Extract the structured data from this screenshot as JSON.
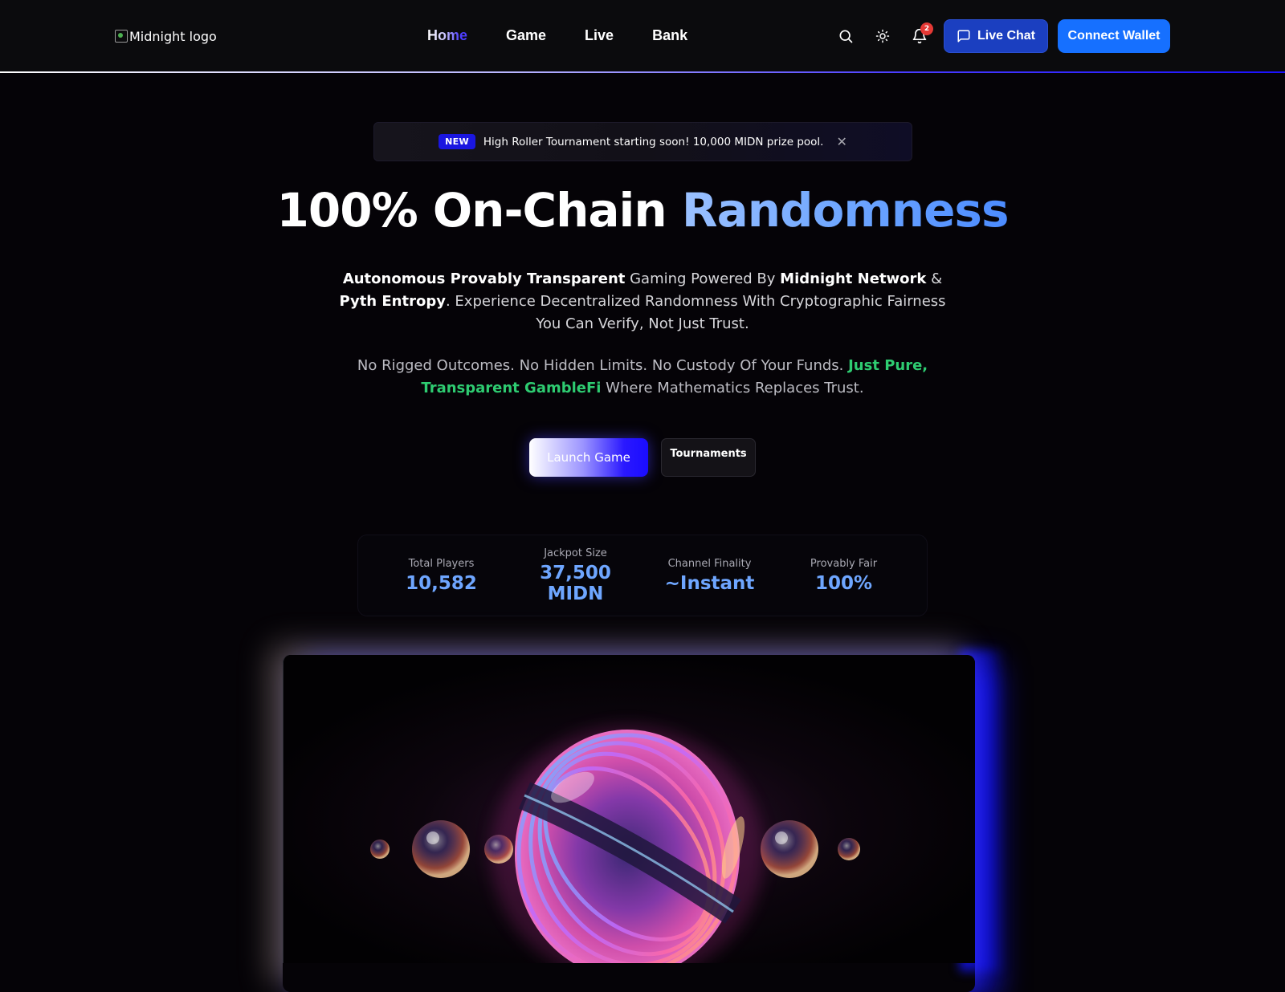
{
  "header": {
    "logo_alt": "Midnight logo",
    "nav": [
      {
        "label": "Home",
        "active": true
      },
      {
        "label": "Game",
        "active": false
      },
      {
        "label": "Live",
        "active": false
      },
      {
        "label": "Bank",
        "active": false
      }
    ],
    "icons": [
      "search-icon",
      "sun-icon",
      "bell-icon",
      "chat-icon"
    ],
    "notification_count": "2",
    "live_chat_label": "Live Chat",
    "connect_wallet_label": "Connect Wallet"
  },
  "announcement": {
    "badge": "NEW",
    "text": "High Roller Tournament starting soon! 10,000 MIDN prize pool.",
    "close_icon": "close-icon"
  },
  "hero": {
    "title_plain": "100% On-Chain ",
    "title_accent": "Randomness",
    "desc_parts": [
      {
        "text": "Autonomous Provably Transparent",
        "bold": true
      },
      {
        "text": " Gaming Powered By ",
        "bold": false
      },
      {
        "text": "Midnight Network",
        "bold": true
      },
      {
        "text": " & ",
        "bold": false
      },
      {
        "text": "Pyth Entropy",
        "bold": true
      },
      {
        "text": ". Experience Decentralized Randomness With Cryptographic Fairness You Can Verify, Not Just Trust.",
        "bold": false
      }
    ],
    "desc2_plain": "No Rigged Outcomes. No Hidden Limits. No Custody Of Your Funds. ",
    "desc2_accent": "Just Pure, Transparent GambleFi",
    "desc2_end": " Where Mathematics Replaces Trust.",
    "launch_label": "Launch Game",
    "tournaments_label": "Tournaments"
  },
  "stats": [
    {
      "label": "Total Players",
      "value": "10,582"
    },
    {
      "label": "Jackpot Size",
      "value": "37,500 MIDN"
    },
    {
      "label": "Channel Finality",
      "value": "~Instant"
    },
    {
      "label": "Provably Fair",
      "value": "100%"
    }
  ],
  "colors": {
    "accent_blue": "#6ea6ff",
    "brand_blue": "#1670ff",
    "live_chat_blue": "#1b3fc0",
    "green": "#2ecc71",
    "badge_red": "#e53935"
  }
}
